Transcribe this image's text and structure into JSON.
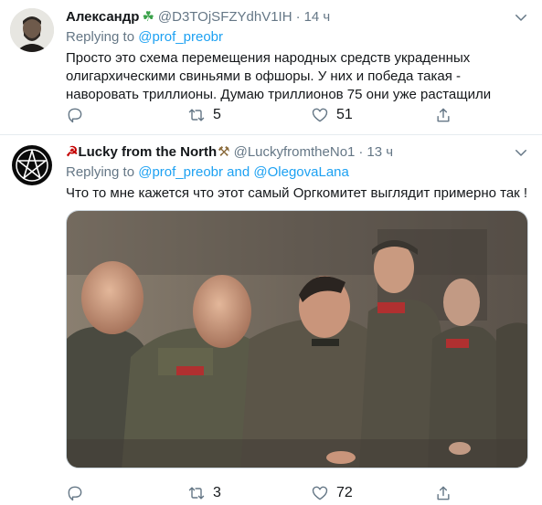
{
  "tweets": [
    {
      "name": "Александр",
      "name_emoji": "☘",
      "handle": "@D3TOjSFZYdhV1IH",
      "separator": "·",
      "time": "14 ч",
      "replying_prefix": "Replying to",
      "mentions": [
        "@prof_preobr"
      ],
      "text_lines": [
        "Просто это схема перемещения народных средств украденных",
        "олигархическими свиньями в офшоры. У них и победа такая -",
        "наворовать триллионы. Думаю триллионов 75 они уже растащили"
      ],
      "reply_count": "",
      "retweet_count": "5",
      "like_count": "51"
    },
    {
      "name_prefix": "☭",
      "name": "Lucky from the North",
      "name_emoji": "⚒",
      "handle": "@LuckyfromtheNo1",
      "separator": "·",
      "time": "13 ч",
      "replying_prefix": "Replying to",
      "mentions": [
        "@prof_preobr",
        "@OlegovaLana"
      ],
      "mention_joiner": "and",
      "text": "Что то мне кажется что этот самый Оргкомитет выглядит примерно так !",
      "reply_count": "",
      "retweet_count": "3",
      "like_count": "72"
    }
  ],
  "colors": {
    "link": "#1da1f2",
    "secondary": "#657786",
    "border": "#e6ecf0",
    "text": "#14171a"
  }
}
